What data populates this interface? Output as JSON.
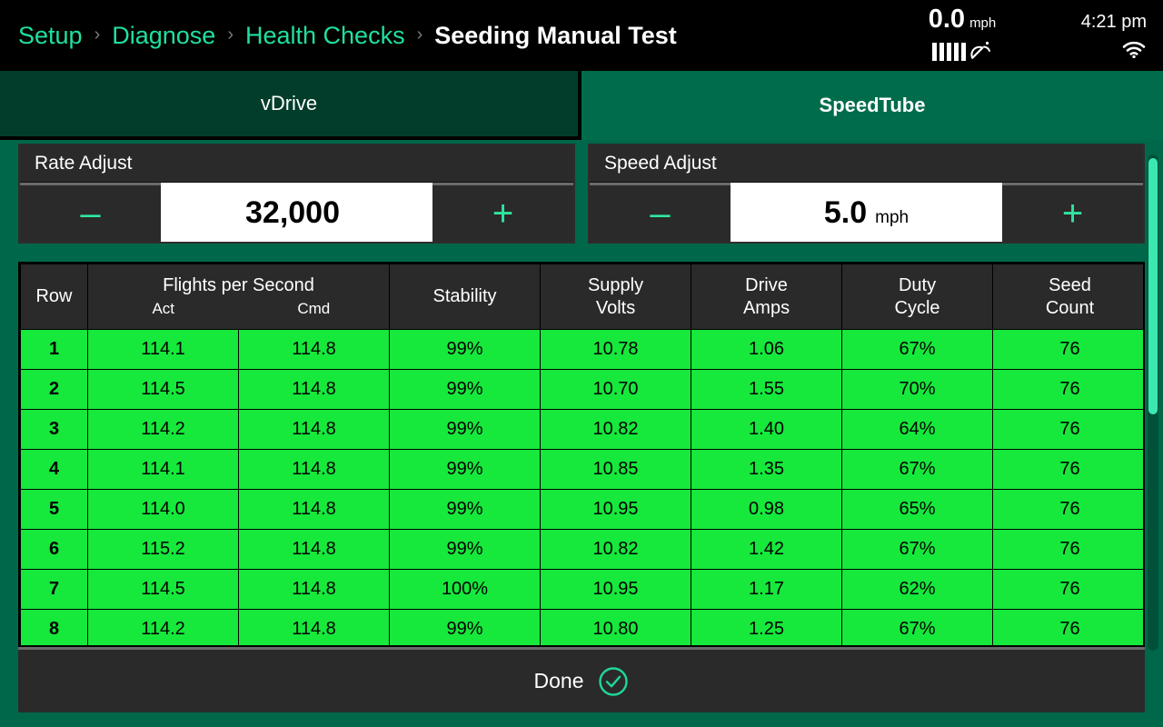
{
  "statusbar": {
    "breadcrumb": [
      {
        "label": "Setup",
        "current": false
      },
      {
        "label": "Diagnose",
        "current": false
      },
      {
        "label": "Health Checks",
        "current": false
      },
      {
        "label": "Seeding Manual Test",
        "current": true
      }
    ],
    "separator": "›",
    "speed_value": "0.0",
    "speed_unit": "mph",
    "gps_icon": "satellite-dish-icon",
    "signal_bars": 5,
    "clock": "4:21 pm",
    "wifi_icon": "wifi-icon"
  },
  "tabs": [
    {
      "label": "vDrive",
      "active": false
    },
    {
      "label": "SpeedTube",
      "active": true
    }
  ],
  "rate_adjust": {
    "title": "Rate Adjust",
    "value": "32,000",
    "unit": "",
    "minus_label": "–",
    "plus_label": "+"
  },
  "speed_adjust": {
    "title": "Speed Adjust",
    "value": "5.0",
    "unit": "mph",
    "minus_label": "–",
    "plus_label": "+"
  },
  "table": {
    "headers": {
      "row": "Row",
      "group_fps": "Flights per Second",
      "fps_act": "Act",
      "fps_cmd": "Cmd",
      "stability": "Stability",
      "supply_volts_l1": "Supply",
      "supply_volts_l2": "Volts",
      "drive_amps_l1": "Drive",
      "drive_amps_l2": "Amps",
      "duty_cycle_l1": "Duty",
      "duty_cycle_l2": "Cycle",
      "seed_count_l1": "Seed",
      "seed_count_l2": "Count"
    },
    "rows": [
      {
        "row": "1",
        "act": "114.1",
        "cmd": "114.8",
        "stability": "99%",
        "volts": "10.78",
        "amps": "1.06",
        "duty": "67%",
        "seed": "76"
      },
      {
        "row": "2",
        "act": "114.5",
        "cmd": "114.8",
        "stability": "99%",
        "volts": "10.70",
        "amps": "1.55",
        "duty": "70%",
        "seed": "76"
      },
      {
        "row": "3",
        "act": "114.2",
        "cmd": "114.8",
        "stability": "99%",
        "volts": "10.82",
        "amps": "1.40",
        "duty": "64%",
        "seed": "76"
      },
      {
        "row": "4",
        "act": "114.1",
        "cmd": "114.8",
        "stability": "99%",
        "volts": "10.85",
        "amps": "1.35",
        "duty": "67%",
        "seed": "76"
      },
      {
        "row": "5",
        "act": "114.0",
        "cmd": "114.8",
        "stability": "99%",
        "volts": "10.95",
        "amps": "0.98",
        "duty": "65%",
        "seed": "76"
      },
      {
        "row": "6",
        "act": "115.2",
        "cmd": "114.8",
        "stability": "99%",
        "volts": "10.82",
        "amps": "1.42",
        "duty": "67%",
        "seed": "76"
      },
      {
        "row": "7",
        "act": "114.5",
        "cmd": "114.8",
        "stability": "100%",
        "volts": "10.95",
        "amps": "1.17",
        "duty": "62%",
        "seed": "76"
      },
      {
        "row": "8",
        "act": "114.2",
        "cmd": "114.8",
        "stability": "99%",
        "volts": "10.80",
        "amps": "1.25",
        "duty": "67%",
        "seed": "76"
      }
    ]
  },
  "footer": {
    "done_label": "Done",
    "done_icon": "check-circle-icon"
  },
  "colors": {
    "accent_green": "#1fe0a0",
    "cell_green": "#16e83c",
    "page_green": "#00684a",
    "tab_active": "#006c4c",
    "tab_inactive": "#013d2a",
    "panel_dark": "#2a2a2a",
    "scroll_thumb": "#3ae8b0"
  }
}
